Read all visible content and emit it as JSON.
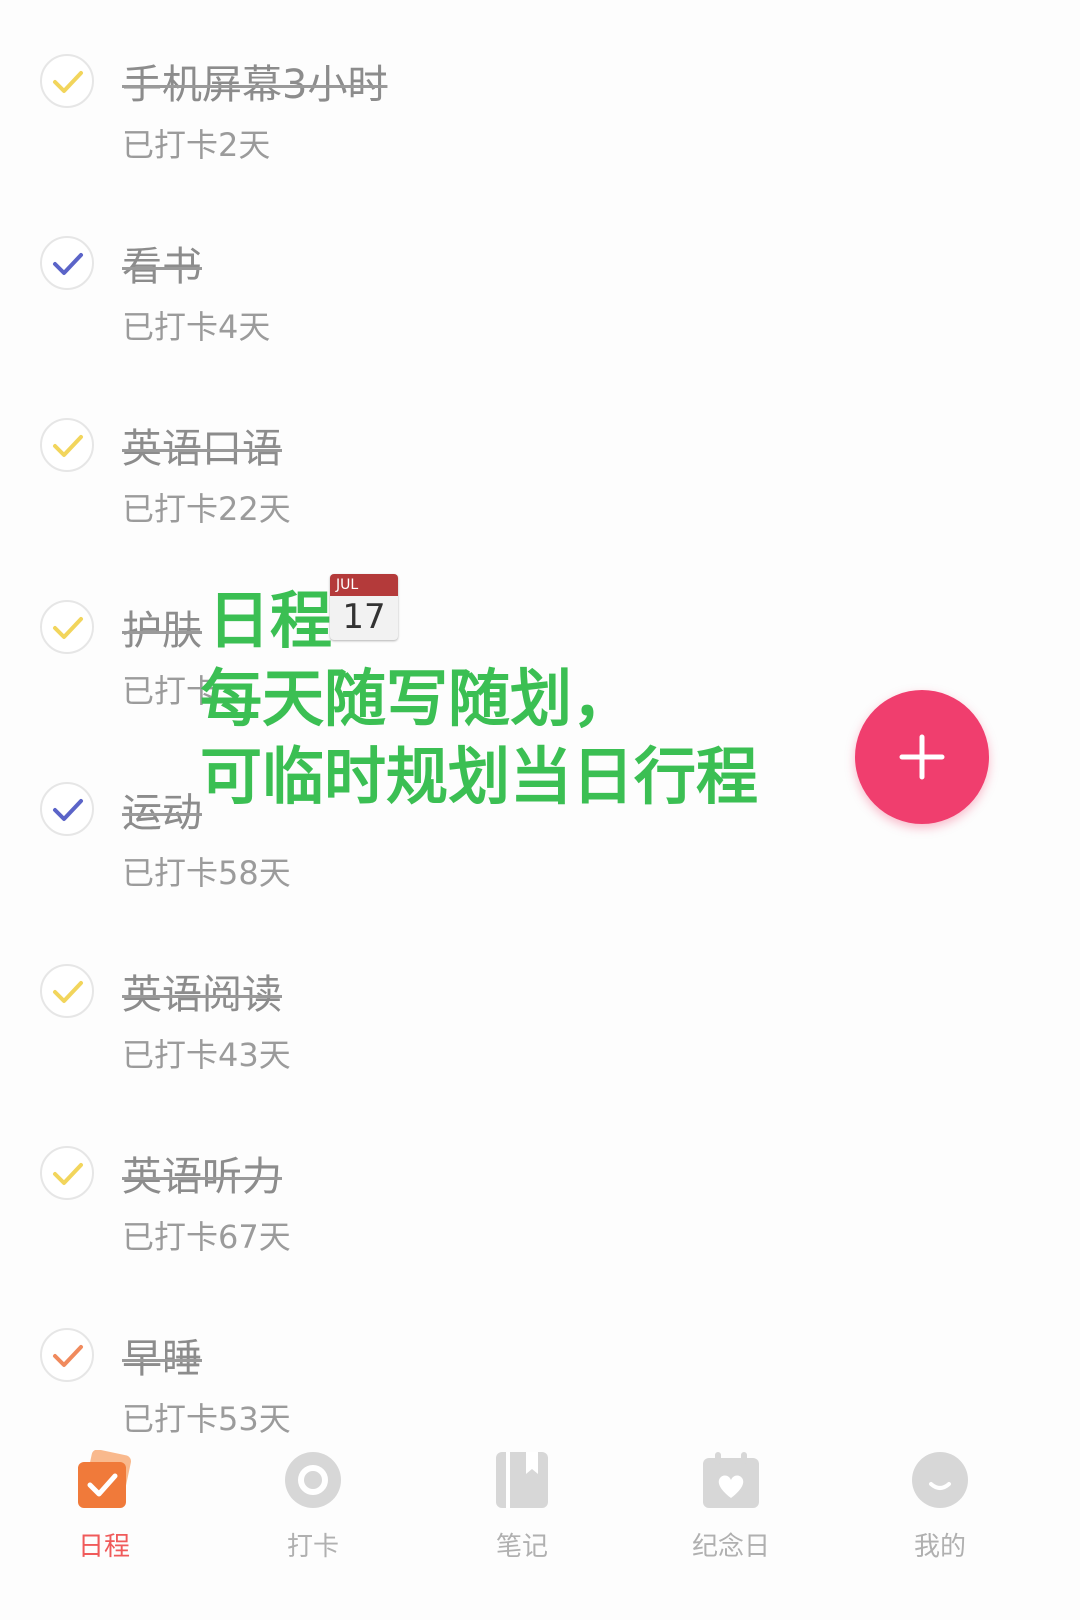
{
  "items": [
    {
      "title": "手机屏幕3小时",
      "sub": "已打卡2天",
      "check_color": "#f2c94c"
    },
    {
      "title": "看书",
      "sub": "已打卡4天",
      "check_color": "#5b64c8"
    },
    {
      "title": "英语口语",
      "sub": "已打卡22天",
      "check_color": "#f2c94c"
    },
    {
      "title": "护肤",
      "sub": "已打卡",
      "check_color": "#f2c94c"
    },
    {
      "title": "运动",
      "sub": "已打卡58天",
      "check_color": "#5b64c8"
    },
    {
      "title": "英语阅读",
      "sub": "已打卡43天",
      "check_color": "#f2c94c"
    },
    {
      "title": "英语听力",
      "sub": "已打卡67天",
      "check_color": "#f2c94c"
    },
    {
      "title": "早睡",
      "sub": "已打卡53天",
      "check_color": "#f08a5d"
    }
  ],
  "overlay": {
    "line1": "日程",
    "line2": "每天随写随划，",
    "line3": "可临时规划当日行程",
    "calendar_month": "JUL",
    "calendar_day": "17"
  },
  "fab": {
    "icon": "plus-icon",
    "color": "#f03e6e"
  },
  "tabs": [
    {
      "label": "日程",
      "icon": "schedule-check-icon",
      "active": true
    },
    {
      "label": "打卡",
      "icon": "punch-circle-icon",
      "active": false
    },
    {
      "label": "笔记",
      "icon": "notebook-icon",
      "active": false
    },
    {
      "label": "纪念日",
      "icon": "anniversary-heart-icon",
      "active": false
    },
    {
      "label": "我的",
      "icon": "profile-face-icon",
      "active": false
    }
  ]
}
